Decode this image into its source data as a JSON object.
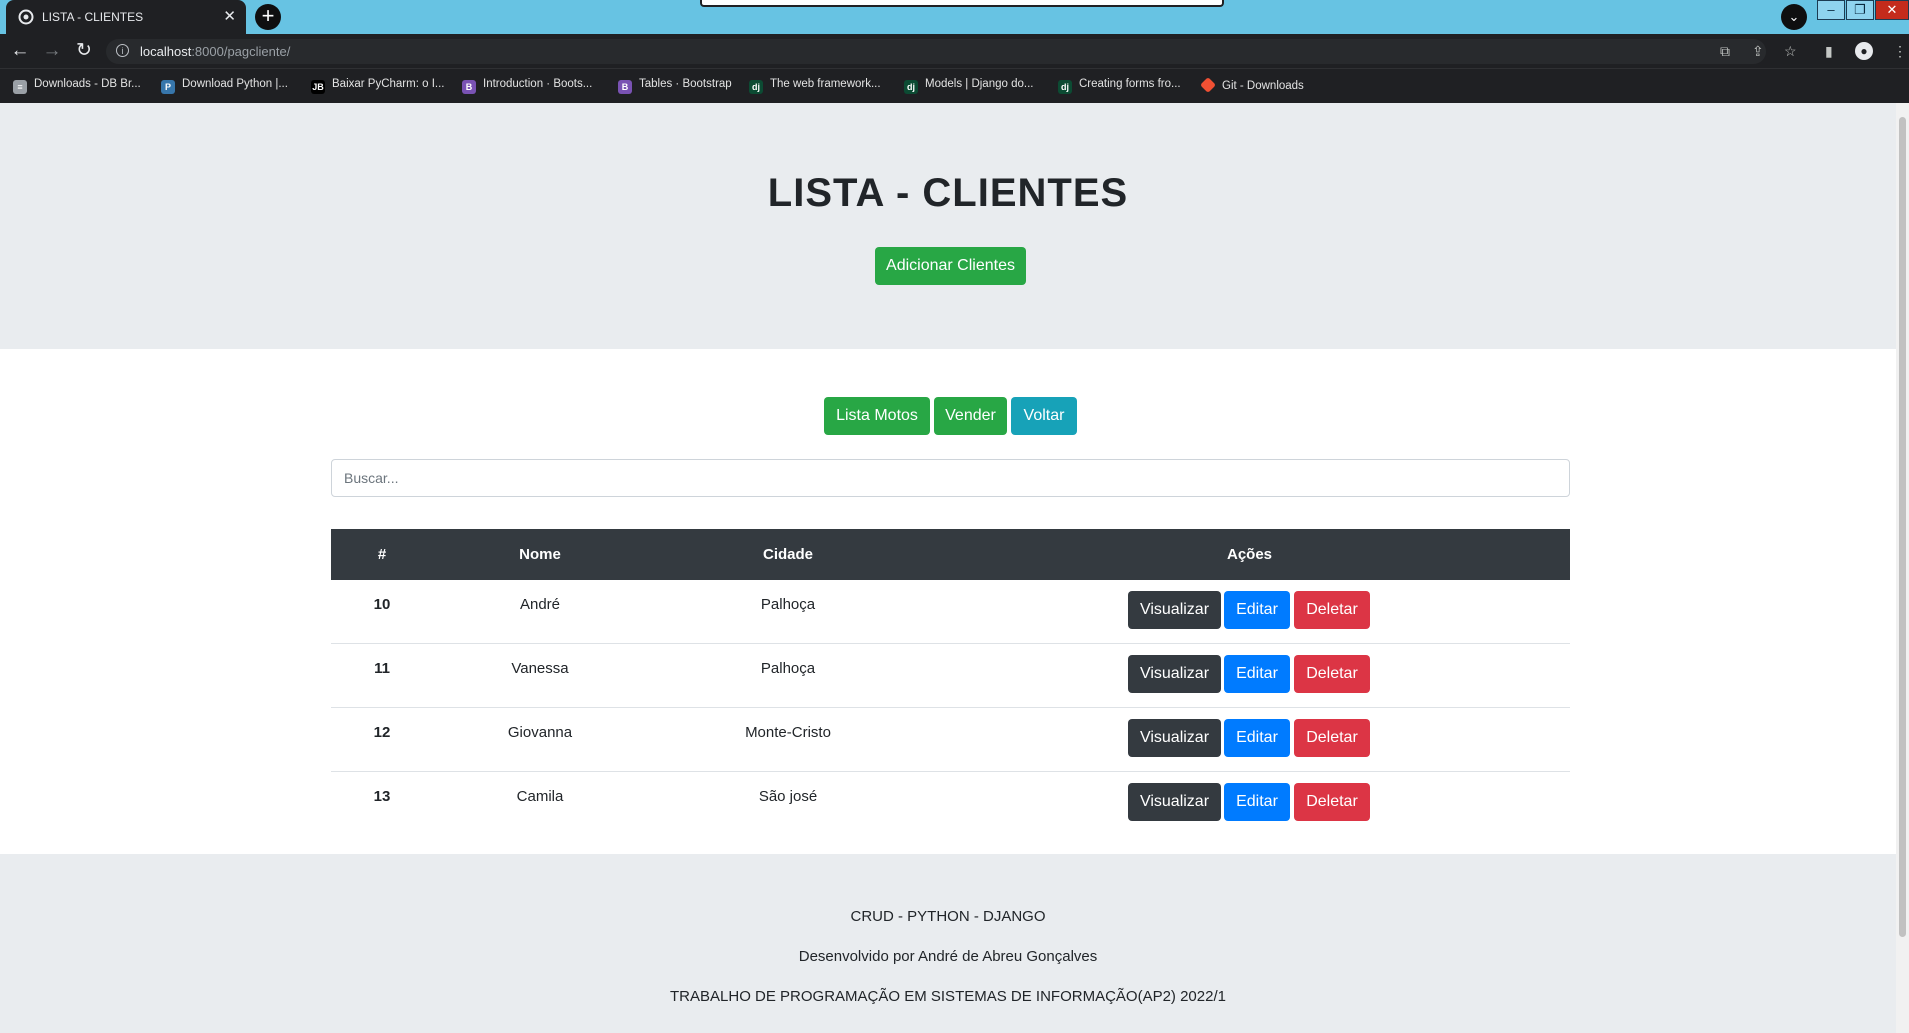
{
  "browser": {
    "tab_title": "LISTA - CLIENTES",
    "tab_close": "✕",
    "new_tab": "+",
    "url_host": "localhost",
    "url_rest": ":8000/pagcliente/",
    "bookmarks": [
      {
        "label": "Downloads - DB Br...",
        "icon": "db-icon"
      },
      {
        "label": "Download Python |...",
        "icon": "python-icon"
      },
      {
        "label": "Baixar PyCharm: o I...",
        "icon": "jetbrains-icon"
      },
      {
        "label": "Introduction · Boots...",
        "icon": "bootstrap-icon"
      },
      {
        "label": "Tables · Bootstrap",
        "icon": "bootstrap-icon"
      },
      {
        "label": "The web framework...",
        "icon": "django-icon"
      },
      {
        "label": "Models | Django do...",
        "icon": "django-icon"
      },
      {
        "label": "Creating forms fro...",
        "icon": "django-icon"
      },
      {
        "label": "Git - Downloads",
        "icon": "git-icon"
      }
    ]
  },
  "header": {
    "title": "LISTA - CLIENTES",
    "add_button": "Adicionar Clientes"
  },
  "nav_buttons": {
    "motos": "Lista Motos",
    "vender": "Vender",
    "voltar": "Voltar"
  },
  "search": {
    "placeholder": "Buscar...",
    "value": ""
  },
  "table": {
    "columns": [
      "#",
      "Nome",
      "Cidade",
      "Ações"
    ],
    "rows": [
      {
        "id": "10",
        "nome": "André",
        "cidade": "Palhoça"
      },
      {
        "id": "11",
        "nome": "Vanessa",
        "cidade": "Palhoça"
      },
      {
        "id": "12",
        "nome": "Giovanna",
        "cidade": "Monte-Cristo"
      },
      {
        "id": "13",
        "nome": "Camila",
        "cidade": "São josé"
      }
    ],
    "actions": {
      "view": "Visualizar",
      "edit": "Editar",
      "delete": "Deletar"
    }
  },
  "footer": {
    "line1": "CRUD - PYTHON - DJANGO",
    "line2": "Desenvolvido por André de Abreu Gonçalves",
    "line3": "TRABALHO DE PROGRAMAÇÃO EM SISTEMAS DE INFORMAÇÃO(AP2) 2022/1"
  },
  "colors": {
    "success": "#28a745",
    "info": "#17a2b8",
    "dark": "#343a40",
    "primary": "#007bff",
    "danger": "#dc3545",
    "jumbotron": "#e9ecef"
  }
}
